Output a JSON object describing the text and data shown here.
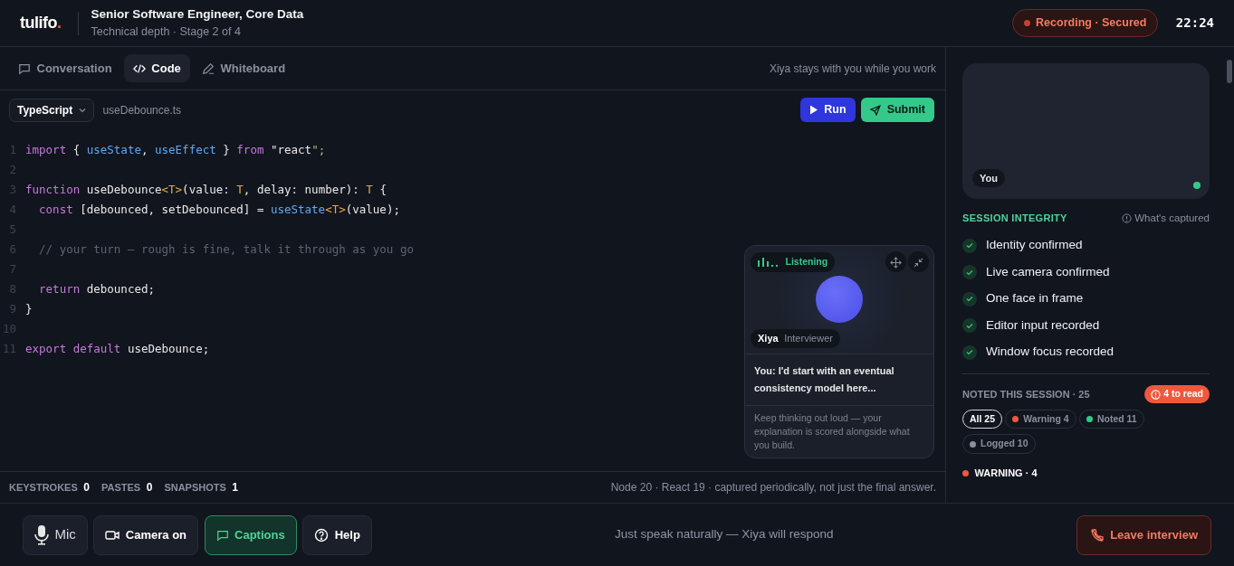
{
  "header": {
    "logo": "tulifo",
    "logo_dot": ".",
    "title": "Senior Software Engineer, Core Data",
    "subtitle": "Technical depth · Stage 2 of 4",
    "recording": "Recording · Secured",
    "timer": "22:24"
  },
  "tabs": [
    {
      "label": "Conversation",
      "selected": false
    },
    {
      "label": "Code",
      "selected": true
    },
    {
      "label": "Whiteboard",
      "selected": false
    }
  ],
  "tabs_note": "Xiya stays with you while you work",
  "editor": {
    "language": "TypeScript",
    "filename": "useDebounce.ts",
    "run": "Run",
    "submit": "Submit",
    "lines": [
      {
        "number": "1",
        "tokens": [
          {
            "text": "import",
            "kind": "kw"
          },
          {
            "text": " { ",
            "kind": "plain"
          },
          {
            "text": "useState",
            "kind": "fn"
          },
          {
            "text": ", ",
            "kind": "plain"
          },
          {
            "text": "useEffect",
            "kind": "fn"
          },
          {
            "text": " } ",
            "kind": "plain"
          },
          {
            "text": "from",
            "kind": "kw"
          },
          {
            "text": " \"react",
            "kind": "plain"
          },
          {
            "text": "\";",
            "kind": "str"
          }
        ]
      },
      {
        "number": "2"
      },
      {
        "number": "3",
        "tokens": [
          {
            "text": "function",
            "kind": "kw"
          },
          {
            "text": " useDebounce",
            "kind": "plain"
          },
          {
            "text": "<T>",
            "kind": "type"
          },
          {
            "text": "(value: ",
            "kind": "plain"
          },
          {
            "text": "T",
            "kind": "type"
          },
          {
            "text": ", delay: number): ",
            "kind": "plain"
          },
          {
            "text": "T",
            "kind": "type"
          },
          {
            "text": " {",
            "kind": "plain"
          }
        ]
      },
      {
        "number": "4",
        "tokens": [
          {
            "text": "  const",
            "kind": "kw"
          },
          {
            "text": " [debounced, setDebounced] = ",
            "kind": "plain"
          },
          {
            "text": "useState",
            "kind": "fn"
          },
          {
            "text": "<T>",
            "kind": "type"
          },
          {
            "text": "(value);",
            "kind": "plain"
          }
        ]
      },
      {
        "number": "5"
      },
      {
        "number": "6",
        "tokens": [
          {
            "text": "  // your turn — rough is fine, talk it through as you go",
            "kind": "comment"
          }
        ]
      },
      {
        "number": "7"
      },
      {
        "number": "8",
        "tokens": [
          {
            "text": "  return",
            "kind": "kw"
          },
          {
            "text": " debounced;",
            "kind": "plain"
          }
        ]
      },
      {
        "number": "9",
        "tokens": [
          {
            "text": "}",
            "kind": "plain"
          }
        ]
      },
      {
        "number": "10"
      },
      {
        "number": "11",
        "tokens": [
          {
            "text": "export default",
            "kind": "kw"
          },
          {
            "text": " useDebounce;",
            "kind": "plain"
          }
        ]
      }
    ]
  },
  "interviewer_card": {
    "status": "Listening",
    "name": "Xiya",
    "role": "Interviewer",
    "transcript": "You: I'd start with an eventual consistency model here...",
    "hint": "Keep thinking out loud — your explanation is scored alongside what you build."
  },
  "stats": [
    {
      "label": "KEYSTROKES",
      "value": "0"
    },
    {
      "label": "PASTES",
      "value": "0"
    },
    {
      "label": "SNAPSHOTS",
      "value": "1"
    }
  ],
  "stats_note": "Node 20 · React 19 · captured periodically, not just the final answer.",
  "sidebar": {
    "self_view_label": "You",
    "integrity_title": "SESSION INTEGRITY",
    "integrity_link": "What's captured",
    "checks": [
      {
        "label": "Identity confirmed",
        "checked": true
      },
      {
        "label": "Live camera confirmed",
        "checked": true
      },
      {
        "label": "One face in frame",
        "checked": true
      },
      {
        "label": "Editor input recorded",
        "checked": true
      },
      {
        "label": "Window focus recorded",
        "checked": true
      }
    ],
    "noted_title": "NOTED THIS SESSION · 25",
    "to_read": "4 to read",
    "filters": [
      {
        "label": "All 25",
        "selected": true
      },
      {
        "label": "Warning 4",
        "selected": false,
        "color": "#f0583e"
      },
      {
        "label": "Noted 11",
        "selected": false,
        "color": "#34c98a"
      },
      {
        "label": "Logged 10",
        "selected": false,
        "color": "#8a909c"
      }
    ],
    "section": {
      "label": "WARNING · 4",
      "color": "#f0583e"
    }
  },
  "footer": {
    "buttons": [
      {
        "label": "Mic",
        "on": false
      },
      {
        "label": "Camera on",
        "on": false
      },
      {
        "label": "Captions",
        "on": true
      },
      {
        "label": "Help",
        "on": false
      }
    ],
    "prompt": "Just speak naturally — Xiya will respond",
    "leave": "Leave interview"
  }
}
